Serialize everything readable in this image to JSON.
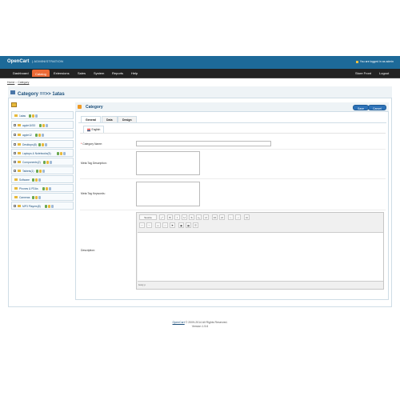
{
  "header": {
    "brand": "OpenCart",
    "brand_suffix": "ADMINISTRATION",
    "logged_in": "You are logged in as admin"
  },
  "menu": {
    "left": [
      "Dashboard",
      "Catalog",
      "Extensions",
      "Sales",
      "System",
      "Reports",
      "Help"
    ],
    "active": "Catalog",
    "right": [
      "Store Front",
      "Logout"
    ]
  },
  "breadcrumb": [
    "Home",
    "Category"
  ],
  "page": {
    "title": "Category ==>> 1atas"
  },
  "tree": {
    "items": [
      {
        "label": "1atas"
      },
      {
        "label": "apple11f33"
      },
      {
        "label": "apple12"
      },
      {
        "label": "Desktops(8)"
      },
      {
        "label": "Laptops & Notebooks(5)"
      },
      {
        "label": "Components(2)"
      },
      {
        "label": "Tablets(1)"
      },
      {
        "label": "Software"
      },
      {
        "label": "Phones & PDAs"
      },
      {
        "label": "Cameras"
      },
      {
        "label": "MP3 Players(8)"
      }
    ]
  },
  "panel": {
    "title": "Category",
    "save_label": "Save",
    "cancel_label": "Cancel",
    "tabs": [
      "General",
      "Data",
      "Design"
    ],
    "active_tab": "General",
    "language_tab": "English"
  },
  "form": {
    "category_name_label": "Category Name:",
    "category_name_required": "*",
    "category_name_value": "",
    "meta_description_label": "Meta Tag Description:",
    "meta_keywords_label": "Meta Tag Keywords:",
    "description_label": "Description:"
  },
  "editor": {
    "source_label": "Source",
    "toolbar_row1": [
      "B",
      "I",
      "U",
      "S",
      "x₂",
      "x²",
      "1≡",
      "•≡",
      "⇤",
      "⇥",
      "Ω"
    ],
    "status": "body  p"
  },
  "footer": {
    "link": "OpenCart",
    "copyright": "© 2009-2014 All Rights Reserved.",
    "version": "Version 1.5.6"
  },
  "colors": {
    "header": "#1d6a99",
    "menu": "#222222",
    "active_menu": "#ec6a36",
    "button": "#2d72b8"
  }
}
